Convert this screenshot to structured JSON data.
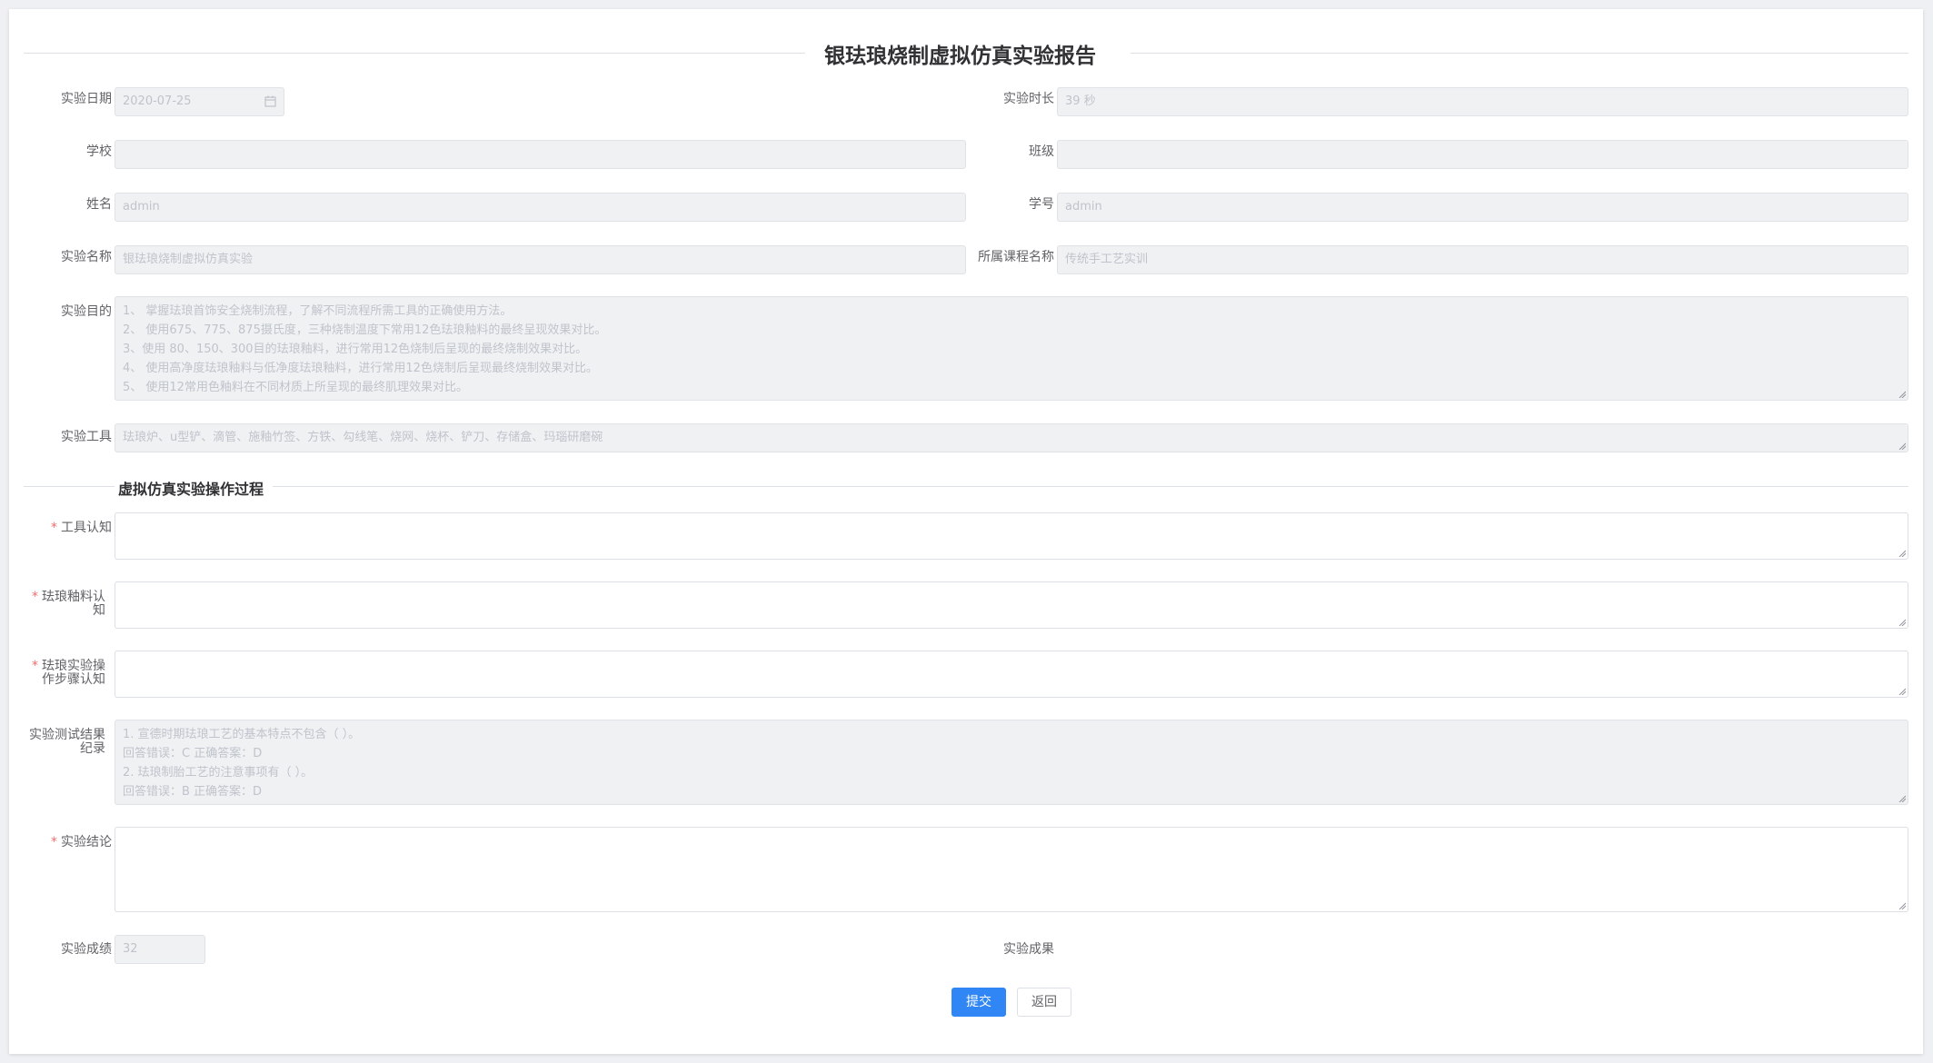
{
  "page": {
    "title": "银珐琅烧制虚拟仿真实验报告"
  },
  "fields": {
    "date": {
      "label": "实验日期",
      "value": "2020-07-25"
    },
    "duration": {
      "label": "实验时长",
      "value": "39 秒"
    },
    "school": {
      "label": "学校",
      "value": ""
    },
    "class": {
      "label": "班级",
      "value": ""
    },
    "name": {
      "label": "姓名",
      "value": "admin"
    },
    "student_id": {
      "label": "学号",
      "value": "admin"
    },
    "experiment_name": {
      "label": "实验名称",
      "value": "银珐琅烧制虚拟仿真实验"
    },
    "course_name": {
      "label": "所属课程名称",
      "value": "传统手工艺实训"
    },
    "purpose": {
      "label": "实验目的",
      "lines": [
        "1、 掌握珐琅首饰安全烧制流程，了解不同流程所需工具的正确使用方法。",
        "2、 使用675、775、875摄氏度，三种烧制温度下常用12色珐琅釉料的最终呈现效果对比。",
        "3、使用 80、150、300目的珐琅釉料，进行常用12色烧制后呈现的最终烧制效果对比。",
        "4、 使用高净度珐琅釉料与低净度珐琅釉料，进行常用12色烧制后呈现最终烧制效果对比。",
        "5、 使用12常用色釉料在不同材质上所呈现的最终肌理效果对比。"
      ]
    },
    "tools": {
      "label": "实验工具",
      "value": "珐琅炉、u型铲、滴管、施釉竹签、方铁、勾线笔、烧网、烧杯、铲刀、存储盒、玛瑙研磨碗"
    }
  },
  "process": {
    "section_title": "虚拟仿真实验操作过程",
    "tool_knowledge": {
      "label": "工具认知",
      "value": ""
    },
    "glaze_knowledge": {
      "label": "珐琅釉料认知",
      "value": ""
    },
    "steps_knowledge": {
      "label": "珐琅实验操作步骤认知",
      "value": ""
    },
    "test_record": {
      "label": "实验测试结果纪录",
      "lines": [
        "1. 宣德时期珐琅工艺的基本特点不包含（  ）。",
        "回答错误：C        正确答案：D",
        "2. 珐琅制胎工艺的注意事项有（  ）。",
        "回答错误：B        正确答案：D"
      ]
    },
    "conclusion": {
      "label": "实验结论",
      "value": ""
    }
  },
  "result": {
    "score": {
      "label": "实验成绩",
      "value": "32"
    },
    "achievement": {
      "label": "实验成果"
    }
  },
  "actions": {
    "submit_label": "提交",
    "back_label": "返回"
  },
  "colors": {
    "primary": "#2f86f4",
    "required": "#f56c6c",
    "disabled_bg": "#f0f1f3"
  },
  "icons": {
    "date_picker": "calendar-icon",
    "textarea_resize": "resize-handle-icon"
  }
}
